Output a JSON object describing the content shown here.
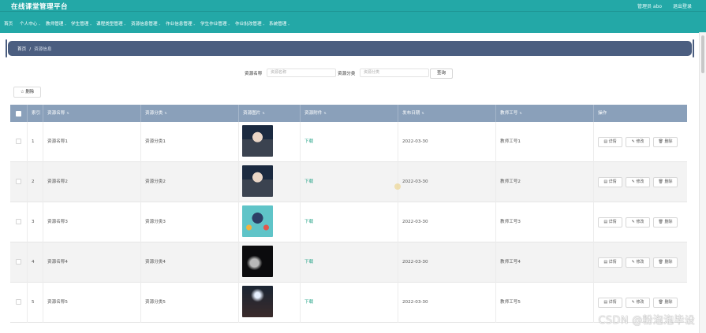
{
  "header": {
    "app_title": "在线课堂管理平台",
    "user_text": "管理员 abo",
    "logout_label": "退出登录"
  },
  "nav": [
    {
      "label": "首页",
      "has_caret": false
    },
    {
      "label": "个人中心",
      "has_caret": true
    },
    {
      "label": "教师管理",
      "has_caret": true
    },
    {
      "label": "学生管理",
      "has_caret": true
    },
    {
      "label": "课程类型管理",
      "has_caret": true
    },
    {
      "label": "资源信息管理",
      "has_caret": true
    },
    {
      "label": "作业信息管理",
      "has_caret": true
    },
    {
      "label": "学生作业管理",
      "has_caret": true
    },
    {
      "label": "作业批改管理",
      "has_caret": true
    },
    {
      "label": "系统管理",
      "has_caret": true
    }
  ],
  "breadcrumb": {
    "home": "首页",
    "sep": "/",
    "current": "资源信息"
  },
  "search": {
    "name_label": "资源名称",
    "name_placeholder": "资源名称",
    "type_label": "资源分类",
    "type_placeholder": "资源分类",
    "query_button": "查询"
  },
  "delete_all_label": "☆ 删除",
  "table": {
    "headers": [
      "索引",
      "资源名称",
      "资源分类",
      "资源图片",
      "资源附件",
      "发布日期",
      "教师工号",
      "操作"
    ],
    "rows": [
      {
        "index": "1",
        "name": "资源名称1",
        "type": "资源分类1",
        "image": "person-computer",
        "attachment": "下载",
        "date": "2022-03-30",
        "teacher_id": "教师工号1"
      },
      {
        "index": "2",
        "name": "资源名称2",
        "type": "资源分类2",
        "image": "person-computer",
        "attachment": "下载",
        "date": "2022-03-30",
        "teacher_id": "教师工号2"
      },
      {
        "index": "3",
        "name": "资源名称3",
        "type": "资源分类3",
        "image": "multitask-illustration",
        "attachment": "下载",
        "date": "2022-03-30",
        "teacher_id": "教师工号3"
      },
      {
        "index": "4",
        "name": "资源名称4",
        "type": "资源分类4",
        "image": "moon-dark",
        "attachment": "下载",
        "date": "2022-03-30",
        "teacher_id": "教师工号4"
      },
      {
        "index": "5",
        "name": "资源名称5",
        "type": "资源分类5",
        "image": "stage-lights",
        "attachment": "下载",
        "date": "2022-03-30",
        "teacher_id": "教师工号5"
      }
    ],
    "actions": {
      "detail": "详情",
      "edit": "修改",
      "delete": "删除"
    }
  },
  "watermark": "CSDN @粉泡泡毕设",
  "colors": {
    "nav": "#23a8a7",
    "breadcrumb": "#4b5e80",
    "table_header": "#8aa0ba",
    "link": "#2aa58a"
  }
}
